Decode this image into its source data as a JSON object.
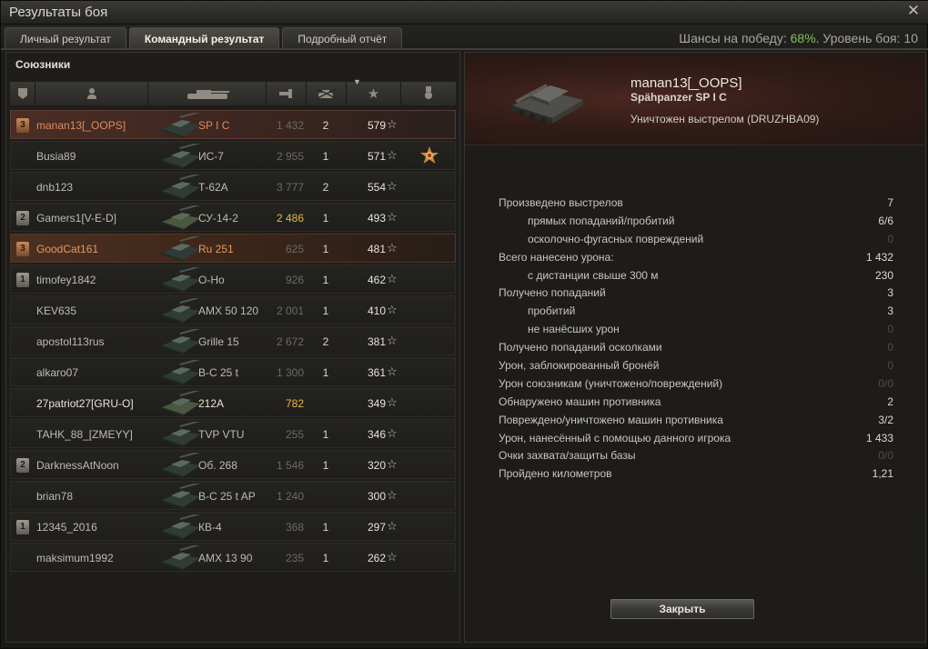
{
  "window": {
    "title": "Результаты боя"
  },
  "tabs": [
    {
      "label": "Личный результат"
    },
    {
      "label": "Командный результат"
    },
    {
      "label": "Подробный отчёт"
    }
  ],
  "battle_info": {
    "chance_prefix": "Шансы на победу: ",
    "chance_value": "68%",
    "level_text": ". Уровень боя: 10"
  },
  "allies": {
    "label": "Союзники",
    "rows": [
      {
        "platoon": "3",
        "name": "manan13[_OOPS]",
        "tank": "SP I C",
        "damage": "1 432",
        "kills": "2",
        "xp": "579"
      },
      {
        "platoon": "",
        "name": "Busia89",
        "tank": "ИС-7",
        "damage": "2 955",
        "kills": "1",
        "xp": "571"
      },
      {
        "platoon": "",
        "name": "dnb123",
        "tank": "Т-62А",
        "damage": "3 777",
        "kills": "2",
        "xp": "554"
      },
      {
        "platoon": "2",
        "name": "Gamers1[V-E-D]",
        "tank": "СУ-14-2",
        "damage": "2 486",
        "kills": "1",
        "xp": "493"
      },
      {
        "platoon": "3",
        "name": "GoodCat161",
        "tank": "Ru 251",
        "damage": "625",
        "kills": "1",
        "xp": "481"
      },
      {
        "platoon": "1",
        "name": "timofey1842",
        "tank": "O-Ho",
        "damage": "926",
        "kills": "1",
        "xp": "462"
      },
      {
        "platoon": "",
        "name": "KEV635",
        "tank": "AMX 50 120",
        "damage": "2 001",
        "kills": "1",
        "xp": "410"
      },
      {
        "platoon": "",
        "name": "apostol113rus",
        "tank": "Grille 15",
        "damage": "2 672",
        "kills": "2",
        "xp": "381"
      },
      {
        "platoon": "",
        "name": "alkaro07",
        "tank": "B-C 25 t",
        "damage": "1 300",
        "kills": "1",
        "xp": "361"
      },
      {
        "platoon": "",
        "name": "27patriot27[GRU-O]",
        "tank": "212A",
        "damage": "782",
        "kills": "",
        "xp": "349"
      },
      {
        "platoon": "",
        "name": "TAHK_88_[ZMEYY]",
        "tank": "TVP VTU",
        "damage": "255",
        "kills": "1",
        "xp": "346"
      },
      {
        "platoon": "2",
        "name": "DarknessAtNoon",
        "tank": "Об. 268",
        "damage": "1 546",
        "kills": "1",
        "xp": "320"
      },
      {
        "platoon": "",
        "name": "brian78",
        "tank": "B-C 25 t AP",
        "damage": "1 240",
        "kills": "",
        "xp": "300"
      },
      {
        "platoon": "1",
        "name": "12345_2016",
        "tank": "КВ-4",
        "damage": "368",
        "kills": "1",
        "xp": "297"
      },
      {
        "platoon": "",
        "name": "maksimum1992",
        "tank": "AMX 13 90",
        "damage": "235",
        "kills": "1",
        "xp": "262"
      }
    ]
  },
  "detail": {
    "player": "manan13[_OOPS]",
    "vehicle": "Spähpanzer SP I C",
    "killed_by": "Уничтожен выстрелом (DRUZHBA09)",
    "stats": [
      {
        "label": "Произведено выстрелов",
        "value": "7"
      },
      {
        "label": "прямых попаданий/пробитий",
        "value": "6/6"
      },
      {
        "label": "осколочно-фугасных повреждений",
        "value": "0"
      },
      {
        "label": "Всего нанесено урона:",
        "value": "1 432"
      },
      {
        "label": "с дистанции свыше 300 м",
        "value": "230"
      },
      {
        "label": "Получено попаданий",
        "value": "3"
      },
      {
        "label": "пробитий",
        "value": "3"
      },
      {
        "label": "не нанёсших урон",
        "value": "0"
      },
      {
        "label": "Получено попаданий осколками",
        "value": "0"
      },
      {
        "label": "Урон, заблокированный бронёй",
        "value": "0"
      },
      {
        "label": "Урон союзникам (уничтожено/повреждений)",
        "value": "0/0"
      },
      {
        "label": "Обнаружено машин противника",
        "value": "2"
      },
      {
        "label": "Повреждено/уничтожено машин противника",
        "value": "3/2"
      },
      {
        "label": "Урон, нанесённый с помощью данного игрока",
        "value": "1 433"
      },
      {
        "label": "Очки захвата/защиты базы",
        "value": "0/0"
      },
      {
        "label": "Пройдено километров",
        "value": "1,21"
      }
    ],
    "close_label": "Закрыть"
  },
  "colors": {
    "accent_win_chance": "#7fc35c",
    "damage_gold": "#e8b646",
    "self_highlight": "#e08b5e"
  }
}
